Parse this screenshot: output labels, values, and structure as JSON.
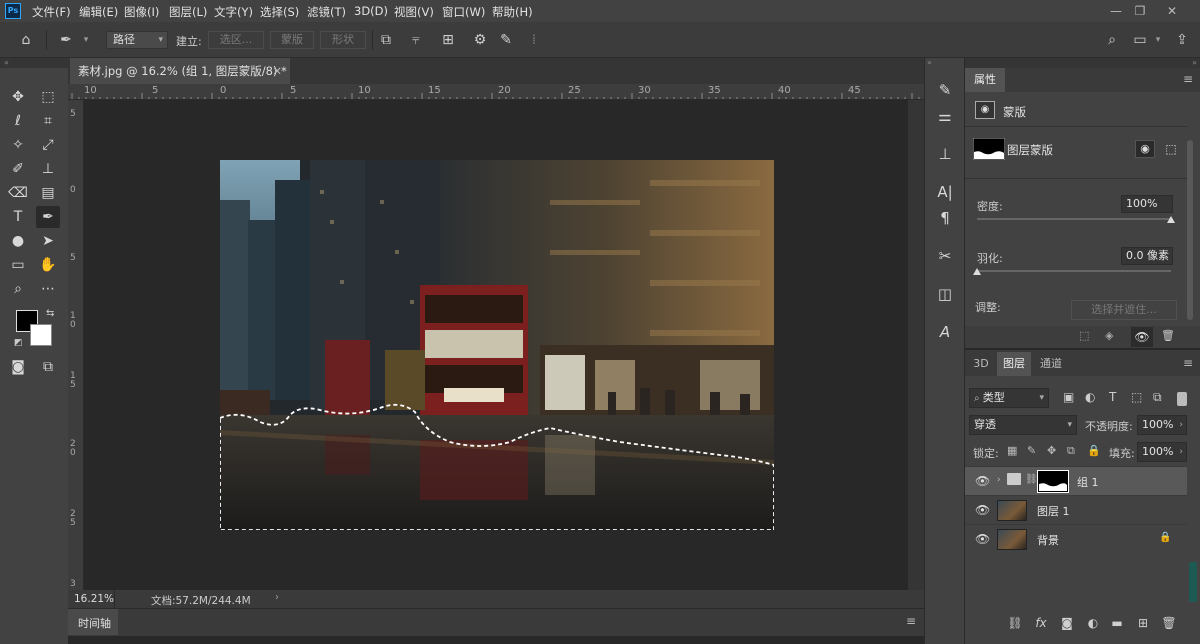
{
  "menu": [
    "文件(F)",
    "编辑(E)",
    "图像(I)",
    "图层(L)",
    "文字(Y)",
    "选择(S)",
    "滤镜(T)",
    "3D(D)",
    "视图(V)",
    "窗口(W)",
    "帮助(H)"
  ],
  "app_logo": "Ps",
  "options_bar": {
    "mode_select": "路径",
    "build_label": "建立:",
    "selection_btn": "选区...",
    "mask_btn": "蒙版",
    "shape_btn": "形状"
  },
  "document": {
    "tab_title": "素材.jpg @ 16.2% (组 1, 图层蒙版/8) *",
    "zoom": "16.21%",
    "doc_size": "文档:57.2M/244.4M"
  },
  "ruler_top": [
    "10",
    "5",
    "0",
    "5",
    "10",
    "15",
    "20",
    "25",
    "30",
    "35",
    "40",
    "45"
  ],
  "ruler_left": [
    "5",
    "0",
    "5",
    "1\n0",
    "1\n5",
    "2\n0",
    "2\n5",
    "3"
  ],
  "timeline_label": "时间轴",
  "properties": {
    "tab": "属性",
    "mask_type": "蒙版",
    "layer_mask_label": "图层蒙版",
    "density_label": "密度:",
    "density_value": "100%",
    "density": 1.0,
    "feather_label": "羽化:",
    "feather_value": "0.0 像素",
    "feather": 0.0,
    "adjust_label": "调整:",
    "select_and_mask_btn": "选择并遮住..."
  },
  "layers_panel": {
    "tabs": [
      "3D",
      "图层",
      "通道"
    ],
    "filter_kind": "类型",
    "blend_mode": "穿透",
    "opacity_label": "不透明度:",
    "opacity_value": "100%",
    "lock_label": "锁定:",
    "fill_label": "填充:",
    "fill_value": "100%",
    "layers": [
      {
        "name": "组 1",
        "type": "group"
      },
      {
        "name": "图层 1",
        "type": "pixel"
      },
      {
        "name": "背景",
        "type": "background"
      }
    ]
  }
}
